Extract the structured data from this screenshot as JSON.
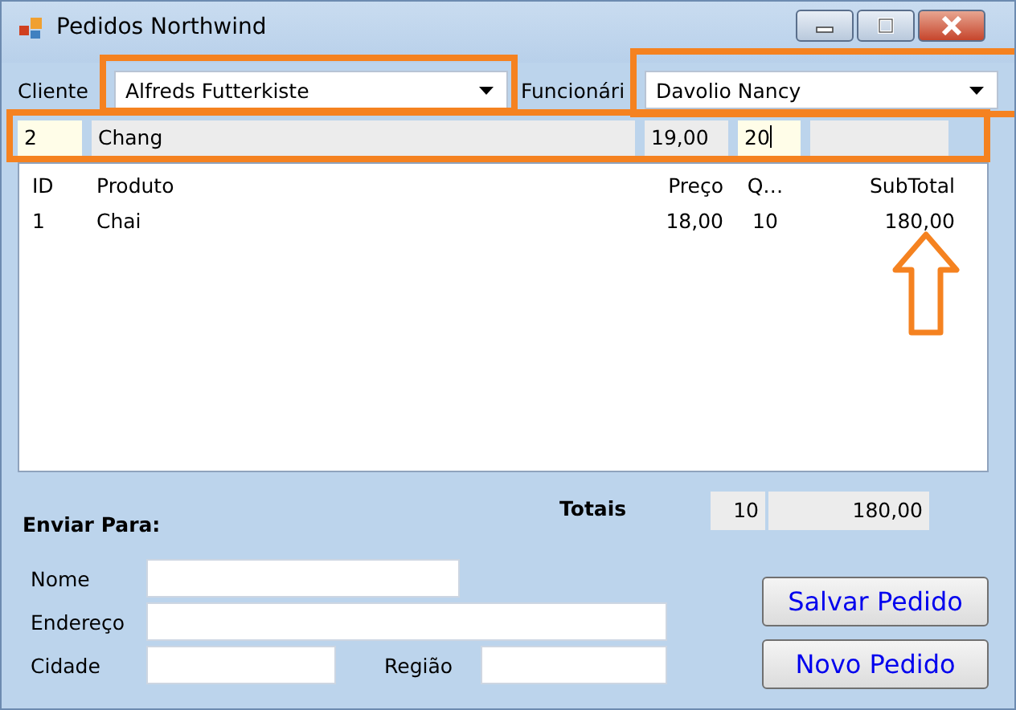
{
  "window": {
    "title": "Pedidos Northwind"
  },
  "cliente": {
    "label": "Cliente",
    "value": "Alfreds Futterkiste"
  },
  "funcionario": {
    "label": "Funcionári",
    "value": "Davolio Nancy"
  },
  "entry": {
    "id": "2",
    "produto": "Chang",
    "preco": "19,00",
    "quantidade": "20"
  },
  "table": {
    "columns": [
      "ID",
      "Produto",
      "Preço",
      "Q…",
      "SubTotal"
    ],
    "rows": [
      [
        "1",
        "Chai",
        "18,00",
        "10",
        "180,00"
      ]
    ]
  },
  "totals": {
    "label": "Totais",
    "quantidade": "10",
    "subtotal": "180,00"
  },
  "ship_to": {
    "title": "Enviar Para:",
    "fields": [
      {
        "label": "Nome"
      },
      {
        "label": "Endereço"
      },
      {
        "label": "Cidade"
      },
      {
        "label": "Região"
      }
    ]
  },
  "buttons": [
    "Salvar Pedido",
    "Novo Pedido"
  ]
}
